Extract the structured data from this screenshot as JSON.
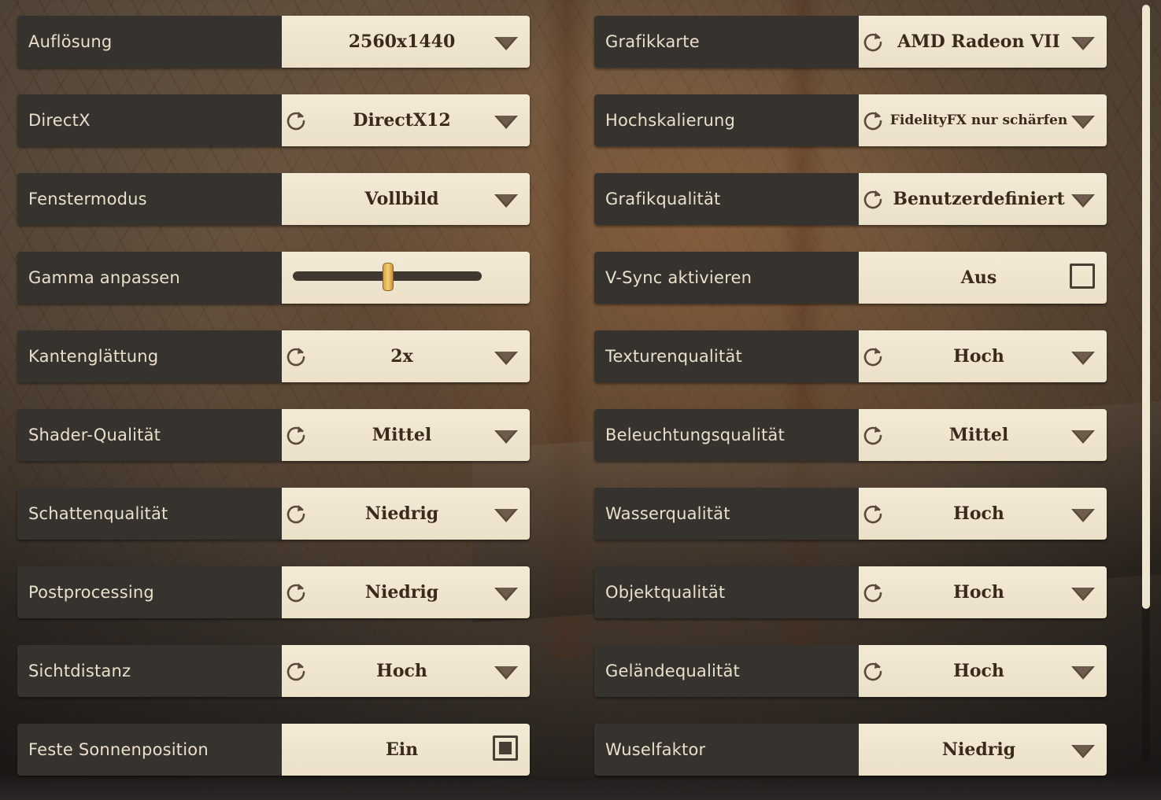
{
  "left_settings": [
    {
      "label": "Auflösung",
      "value": "2560x1440",
      "type": "dropdown",
      "reset": false
    },
    {
      "label": "DirectX",
      "value": "DirectX12",
      "type": "dropdown",
      "reset": true
    },
    {
      "label": "Fenstermodus",
      "value": "Vollbild",
      "type": "dropdown",
      "reset": false
    },
    {
      "label": "Gamma anpassen",
      "type": "slider",
      "level": 0.5
    },
    {
      "label": "Kantenglättung",
      "value": "2x",
      "type": "dropdown",
      "reset": true
    },
    {
      "label": "Shader-Qualität",
      "value": "Mittel",
      "type": "dropdown",
      "reset": true
    },
    {
      "label": "Schattenqualität",
      "value": "Niedrig",
      "type": "dropdown",
      "reset": true
    },
    {
      "label": "Postprocessing",
      "value": "Niedrig",
      "type": "dropdown",
      "reset": true
    },
    {
      "label": "Sichtdistanz",
      "value": "Hoch",
      "type": "dropdown",
      "reset": true
    },
    {
      "label": "Feste Sonnenposition",
      "value": "Ein",
      "type": "checkbox",
      "checked": true
    }
  ],
  "right_settings": [
    {
      "label": "Grafikkarte",
      "value": "AMD Radeon VII",
      "type": "dropdown",
      "reset": true
    },
    {
      "label": "Hochskalierung",
      "value": "FidelityFX nur schärfen",
      "type": "dropdown",
      "reset": true
    },
    {
      "label": "Grafikqualität",
      "value": "Benutzerdefiniert",
      "type": "dropdown",
      "reset": true
    },
    {
      "label": "V-Sync aktivieren",
      "value": "Aus",
      "type": "checkbox",
      "checked": false
    },
    {
      "label": "Texturenqualität",
      "value": "Hoch",
      "type": "dropdown",
      "reset": true
    },
    {
      "label": "Beleuchtungsqualität",
      "value": "Mittel",
      "type": "dropdown",
      "reset": true
    },
    {
      "label": "Wasserqualität",
      "value": "Hoch",
      "type": "dropdown",
      "reset": true
    },
    {
      "label": "Objektqualität",
      "value": "Hoch",
      "type": "dropdown",
      "reset": true
    },
    {
      "label": "Geländequalität",
      "value": "Hoch",
      "type": "dropdown",
      "reset": true
    },
    {
      "label": "Wuselfaktor",
      "value": "Niedrig",
      "type": "dropdown",
      "reset": false
    }
  ],
  "icons": {
    "reset": "refresh-icon",
    "dropdown": "chevron-down-icon",
    "checkbox": "checkbox-icon"
  },
  "colors": {
    "label_bg": "#36322d",
    "label_text": "#e9dfcc",
    "control_bg": "#f3ead6",
    "value_text": "#3a2a1c",
    "icon": "#5a4a3c",
    "slider_thumb": "#f0c264"
  }
}
